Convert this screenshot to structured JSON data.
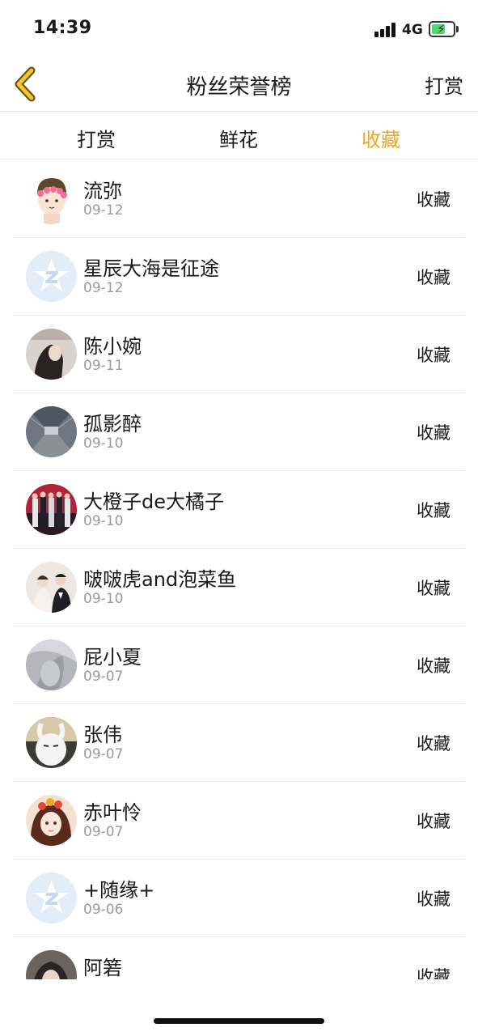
{
  "status_bar": {
    "time": "14:39",
    "network": "4G"
  },
  "nav": {
    "title": "粉丝荣誉榜",
    "action": "打赏"
  },
  "tabs": [
    {
      "label": "打赏"
    },
    {
      "label": "鲜花"
    },
    {
      "label": "收藏"
    }
  ],
  "active_tab": "收藏",
  "accent_color": "#f0a623",
  "fans": [
    {
      "name": "流弥",
      "date": "09-12",
      "action": "收藏",
      "avatar": "cartoon-boy"
    },
    {
      "name": "星辰大海是征途",
      "date": "09-12",
      "action": "收藏",
      "avatar": "default-z"
    },
    {
      "name": "陈小婉",
      "date": "09-11",
      "action": "收藏",
      "avatar": "photo-girl"
    },
    {
      "name": "孤影醉",
      "date": "09-10",
      "action": "收藏",
      "avatar": "photo-tunnel"
    },
    {
      "name": "大橙子de大橘子",
      "date": "09-10",
      "action": "收藏",
      "avatar": "photo-group"
    },
    {
      "name": "啵啵虎and泡菜鱼",
      "date": "09-10",
      "action": "收藏",
      "avatar": "photo-couple"
    },
    {
      "name": "屁小夏",
      "date": "09-07",
      "action": "收藏",
      "avatar": "photo-blur"
    },
    {
      "name": "张伟",
      "date": "09-07",
      "action": "收藏",
      "avatar": "cartoon-rabbit"
    },
    {
      "name": "赤叶怜",
      "date": "09-07",
      "action": "收藏",
      "avatar": "anime-girl"
    },
    {
      "name": "+随缘+",
      "date": "09-06",
      "action": "收藏",
      "avatar": "default-z"
    },
    {
      "name": "阿箬",
      "date": "",
      "action": "收藏",
      "avatar": "photo-dark"
    }
  ]
}
